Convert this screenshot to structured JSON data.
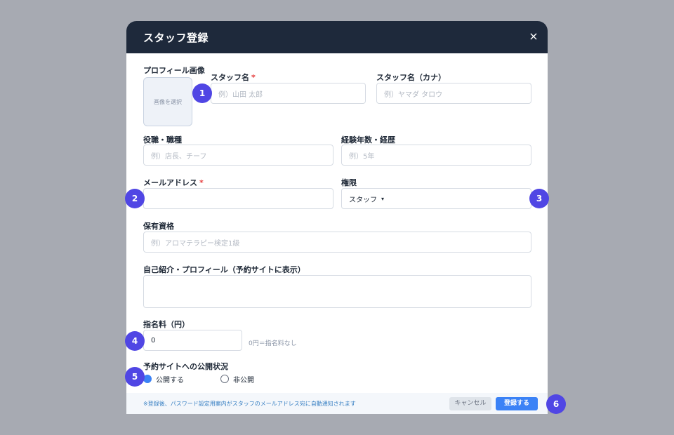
{
  "modal": {
    "title": "スタッフ登録",
    "close_icon": "×"
  },
  "profile_image": {
    "label": "プロフィール画像",
    "button_text": "画像を選択"
  },
  "fields": {
    "staff_name": {
      "label": "スタッフ名",
      "required_mark": "*",
      "placeholder": "例）山田 太郎"
    },
    "staff_kana": {
      "label": "スタッフ名（カナ）",
      "placeholder": "例）ヤマダ タロウ"
    },
    "position": {
      "label": "役職・職種",
      "placeholder": "例）店長、チーフ"
    },
    "experience": {
      "label": "経験年数・経歴",
      "placeholder": "例）5年"
    },
    "email": {
      "label": "メールアドレス",
      "required_mark": "*",
      "value": ""
    },
    "role": {
      "label": "権限",
      "selected": "スタッフ",
      "caret": "▾"
    },
    "qualifications": {
      "label": "保有資格",
      "placeholder": "例）アロマテラピー検定1級"
    },
    "bio": {
      "label": "自己紹介・プロフィール（予約サイトに表示）",
      "value": ""
    },
    "fee": {
      "label": "指名料（円）",
      "value": "0",
      "hint": "0円＝指名料なし"
    },
    "visibility": {
      "label": "予約サイトへの公開状況",
      "options": [
        "公開する",
        "非公開"
      ],
      "selected": "公開する"
    }
  },
  "footer": {
    "notice": "※登録後、パスワード設定用案内がスタッフのメールアドレス宛に自動通知されます",
    "cancel_label": "キャンセル",
    "submit_label": "登録する"
  },
  "badges": [
    "1",
    "2",
    "3",
    "4",
    "5",
    "6"
  ],
  "colors": {
    "header_bg": "#1e293b",
    "accent": "#3b82f6",
    "badge": "#5046e4",
    "required": "#e53e3e",
    "overlay": "#a7aab2"
  }
}
